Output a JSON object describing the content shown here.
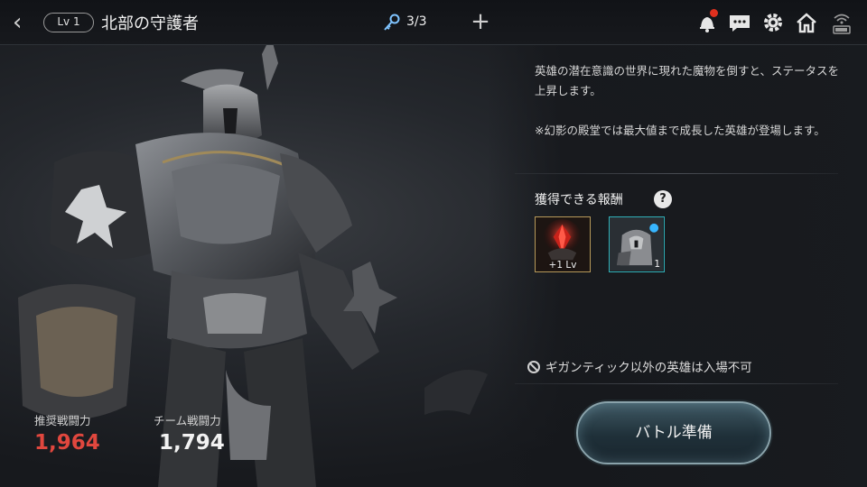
{
  "header": {
    "level": "Lv 1",
    "title": "北部の守護者",
    "keys": "3/3",
    "icons": [
      "back-icon",
      "key-icon",
      "plus-icon",
      "bell-icon",
      "chat-icon",
      "gear-icon",
      "home-icon",
      "wifi-battery-icon"
    ]
  },
  "panel": {
    "description1": "英雄の潜在意識の世界に現れた魔物を倒すと、ステータスを上昇します。",
    "description2": "※幻影の殿堂では最大値まで成長した英雄が登場します。",
    "reward_label": "獲得できる報酬",
    "help": "?",
    "rewards": [
      {
        "label": "+1 Lv",
        "icon": "red-gem-icon"
      },
      {
        "label": "1",
        "icon": "knight-portrait-icon"
      }
    ],
    "restriction": "ギガンティック以外の英雄は入場不可",
    "battle_button": "バトル準備"
  },
  "stats": {
    "recommended_label": "推奨戦闘力",
    "recommended_value": "1,964",
    "team_label": "チーム戦闘力",
    "team_value": "1,794"
  },
  "colors": {
    "recommended_power": "#e0473e",
    "reward_frame_gold": "#b89a5a",
    "reward_frame_teal": "#2fb0b8",
    "notification_dot": "#e0301e"
  }
}
